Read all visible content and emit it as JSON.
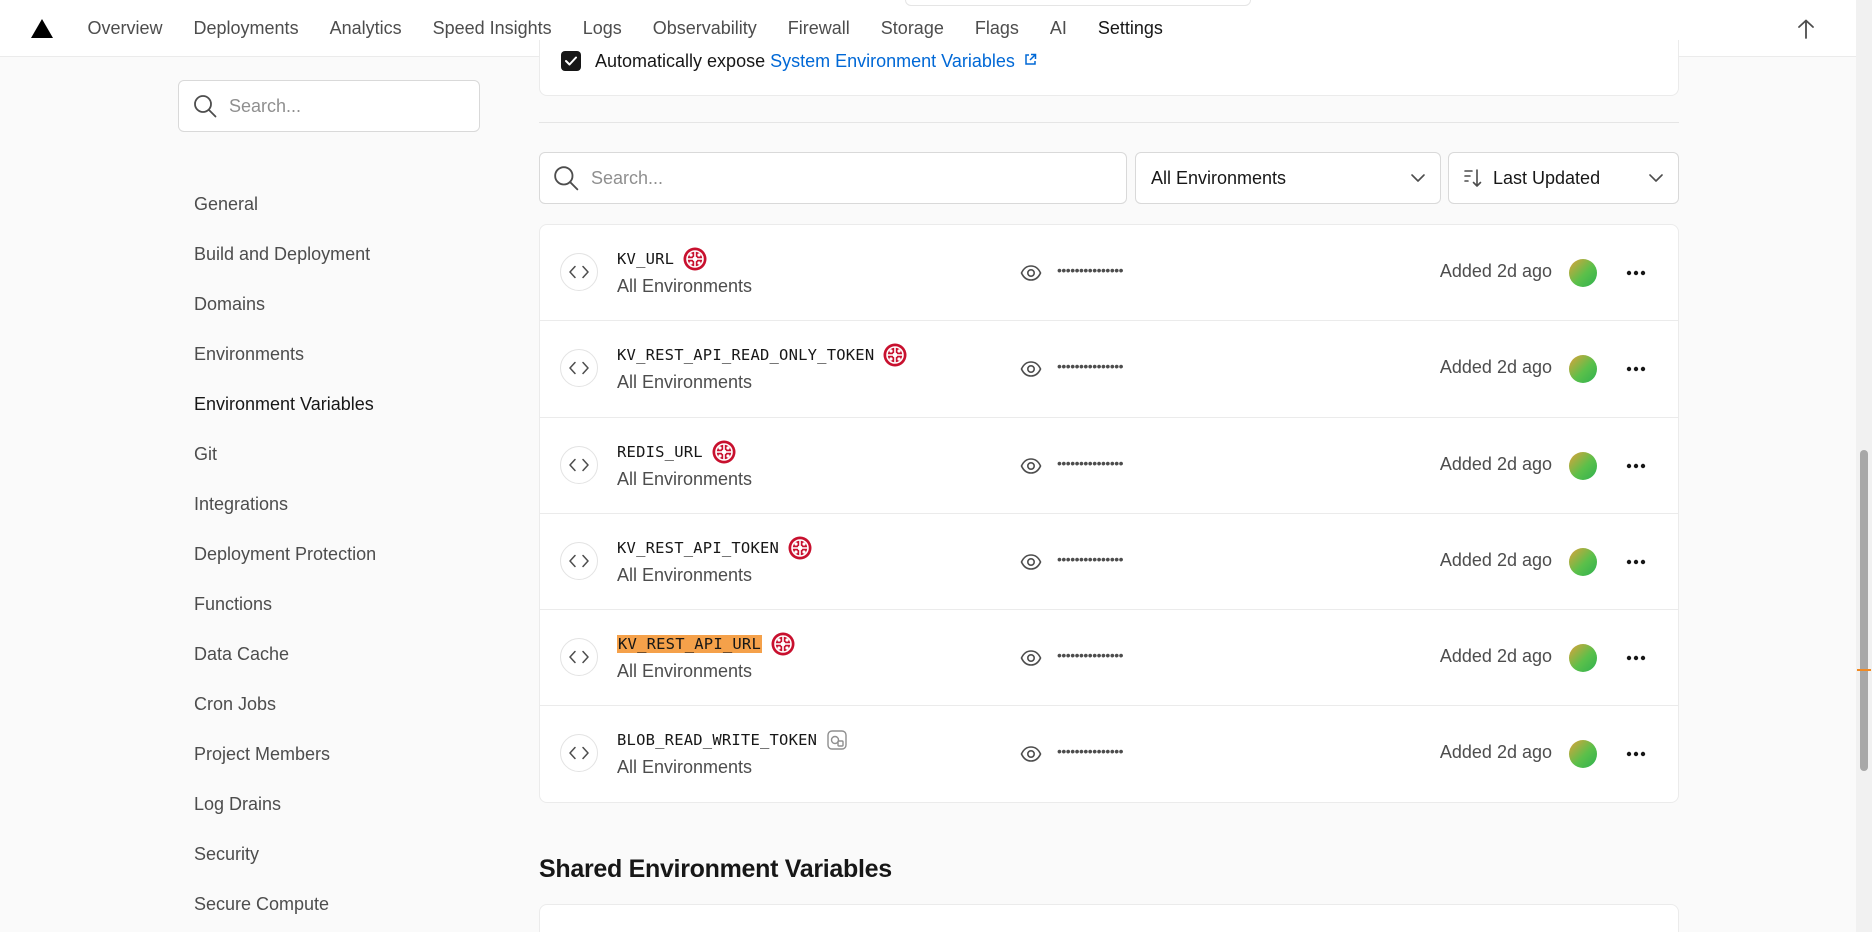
{
  "nav": {
    "tabs": [
      "Overview",
      "Deployments",
      "Analytics",
      "Speed Insights",
      "Logs",
      "Observability",
      "Firewall",
      "Storage",
      "Flags",
      "AI",
      "Settings"
    ],
    "active_tab": "Settings"
  },
  "sidebar": {
    "search_placeholder": "Search...",
    "items": [
      "General",
      "Build and Deployment",
      "Domains",
      "Environments",
      "Environment Variables",
      "Git",
      "Integrations",
      "Deployment Protection",
      "Functions",
      "Data Cache",
      "Cron Jobs",
      "Project Members",
      "Log Drains",
      "Security",
      "Secure Compute"
    ],
    "active_item": "Environment Variables"
  },
  "expose": {
    "text": "Automatically expose",
    "link": "System Environment Variables",
    "checked": true
  },
  "filters": {
    "search_placeholder": "Search...",
    "environment": "All Environments",
    "sort": "Last Updated"
  },
  "variables": [
    {
      "name": "KV_URL",
      "env": "All Environments",
      "masked": "•••••••••••••••",
      "added": "Added 2d ago",
      "badge": "redis-icon",
      "highlight": false
    },
    {
      "name": "KV_REST_API_READ_ONLY_TOKEN",
      "env": "All Environments",
      "masked": "•••••••••••••••",
      "added": "Added 2d ago",
      "badge": "redis-icon",
      "highlight": false
    },
    {
      "name": "REDIS_URL",
      "env": "All Environments",
      "masked": "•••••••••••••••",
      "added": "Added 2d ago",
      "badge": "redis-icon",
      "highlight": false
    },
    {
      "name": "KV_REST_API_TOKEN",
      "env": "All Environments",
      "masked": "•••••••••••••••",
      "added": "Added 2d ago",
      "badge": "redis-icon",
      "highlight": false
    },
    {
      "name": "KV_REST_API_URL",
      "env": "All Environments",
      "masked": "•••••••••••••••",
      "added": "Added 2d ago",
      "badge": "redis-icon",
      "highlight": true
    },
    {
      "name": "BLOB_READ_WRITE_TOKEN",
      "env": "All Environments",
      "masked": "•••••••••••••••",
      "added": "Added 2d ago",
      "badge": "blob-icon",
      "highlight": false
    }
  ],
  "shared": {
    "title": "Shared Environment Variables"
  },
  "colors": {
    "accent_link": "#0068d6",
    "highlight": "#f5a14a",
    "redis_badge": "#c8102e"
  }
}
